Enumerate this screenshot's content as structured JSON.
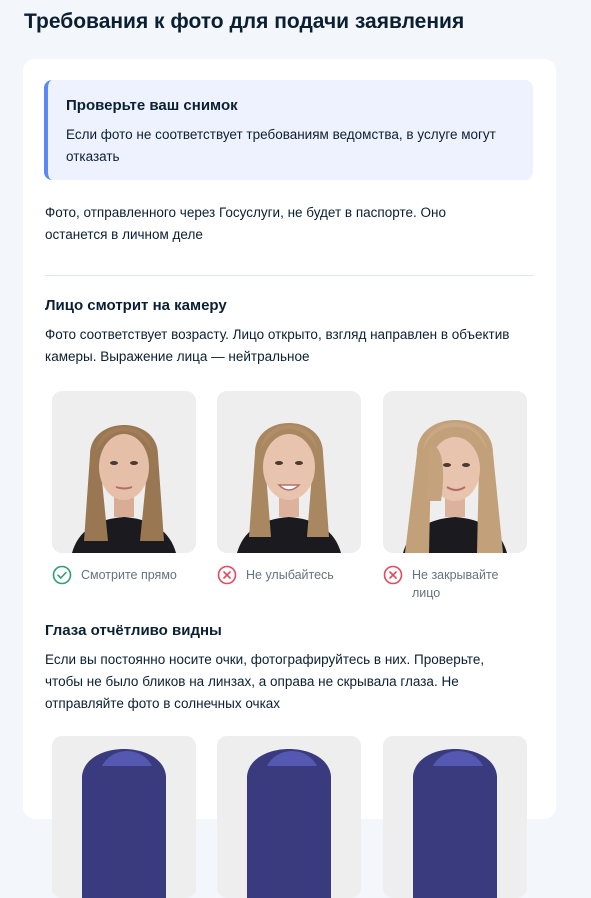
{
  "page": {
    "title": "Требования к фото для подачи заявления"
  },
  "notice": {
    "title": "Проверьте ваш снимок",
    "text": "Если фото не соответствует требованиям ведомства, в услуге могут отказать"
  },
  "intro_text": "Фото, отправленного через Госуслуги, не будет в паспорте. Оно останется в личном деле",
  "sections": [
    {
      "title": "Лицо смотрит на камеру",
      "text": "Фото соответствует возрасту. Лицо открыто, взгляд направлен в объектив камеры. Выражение лица — нейтральное",
      "examples": [
        {
          "status": "ok",
          "icon": "check-circle-icon",
          "caption": "Смотрите прямо"
        },
        {
          "status": "bad",
          "icon": "cross-circle-icon",
          "caption": "Не улыбайтесь"
        },
        {
          "status": "bad",
          "icon": "cross-circle-icon",
          "caption": "Не закрывайте лицо"
        }
      ]
    },
    {
      "title": "Глаза отчётливо видны",
      "text": "Если вы постоянно носите очки, фотографируйтесь в них. Проверьте, чтобы не было бликов на линзах, а оправа не скрывала глаза. Не отправляйте фото в солнечных очках"
    }
  ],
  "colors": {
    "ok": "#2f9d74",
    "bad": "#e14a5f",
    "accent": "#5a88f5",
    "notice_bg": "#edf2fe",
    "text": "#0b1f33",
    "muted": "#66727f"
  }
}
